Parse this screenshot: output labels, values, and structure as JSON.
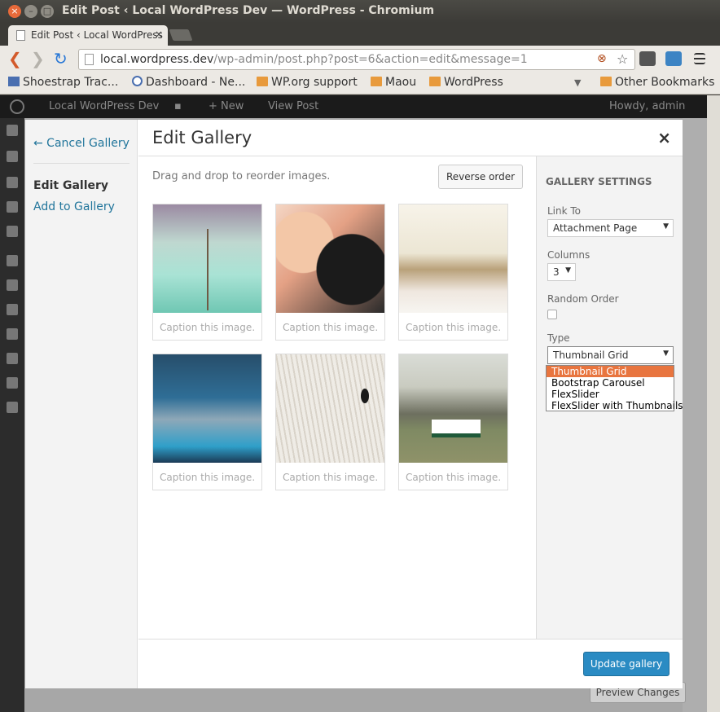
{
  "window": {
    "title": "Edit Post ‹ Local WordPress Dev — WordPress - Chromium"
  },
  "tab": {
    "label": "Edit Post ‹ Local WordPress",
    "close": "×"
  },
  "omnibox": {
    "host": "local.wordpress.dev",
    "path": "/wp-admin/post.php?post=6&action=edit&message=1"
  },
  "bookmarks": {
    "items": [
      "Shoestrap Trac...",
      "Dashboard - Ne...",
      "WP.org support",
      "Maou",
      "WordPress"
    ],
    "other": "Other Bookmarks"
  },
  "adminbar": {
    "site": "Local WordPress Dev",
    "new": "New",
    "view": "View Post",
    "howdy": "Howdy, admin"
  },
  "preview_label": "Preview Changes",
  "modal": {
    "cancel": "← Cancel Gallery",
    "menu_active": "Edit Gallery",
    "menu_add": "Add to Gallery",
    "title": "Edit Gallery",
    "close": "×",
    "drag_hint": "Drag and drop to reorder images.",
    "reverse": "Reverse order",
    "caption_placeholder": "Caption this image…",
    "update": "Update gallery"
  },
  "settings": {
    "heading": "GALLERY SETTINGS",
    "link_to_label": "Link To",
    "link_to_value": "Attachment Page",
    "columns_label": "Columns",
    "columns_value": "3",
    "random_label": "Random Order",
    "type_label": "Type",
    "type_value": "Thumbnail Grid",
    "type_options": [
      "Thumbnail Grid",
      "Bootstrap Carousel",
      "FlexSlider",
      "FlexSlider with Thumbnails"
    ]
  },
  "colors": {
    "accent": "#2a8bc3",
    "link": "#21759b",
    "selected_option": "#e8753f"
  }
}
